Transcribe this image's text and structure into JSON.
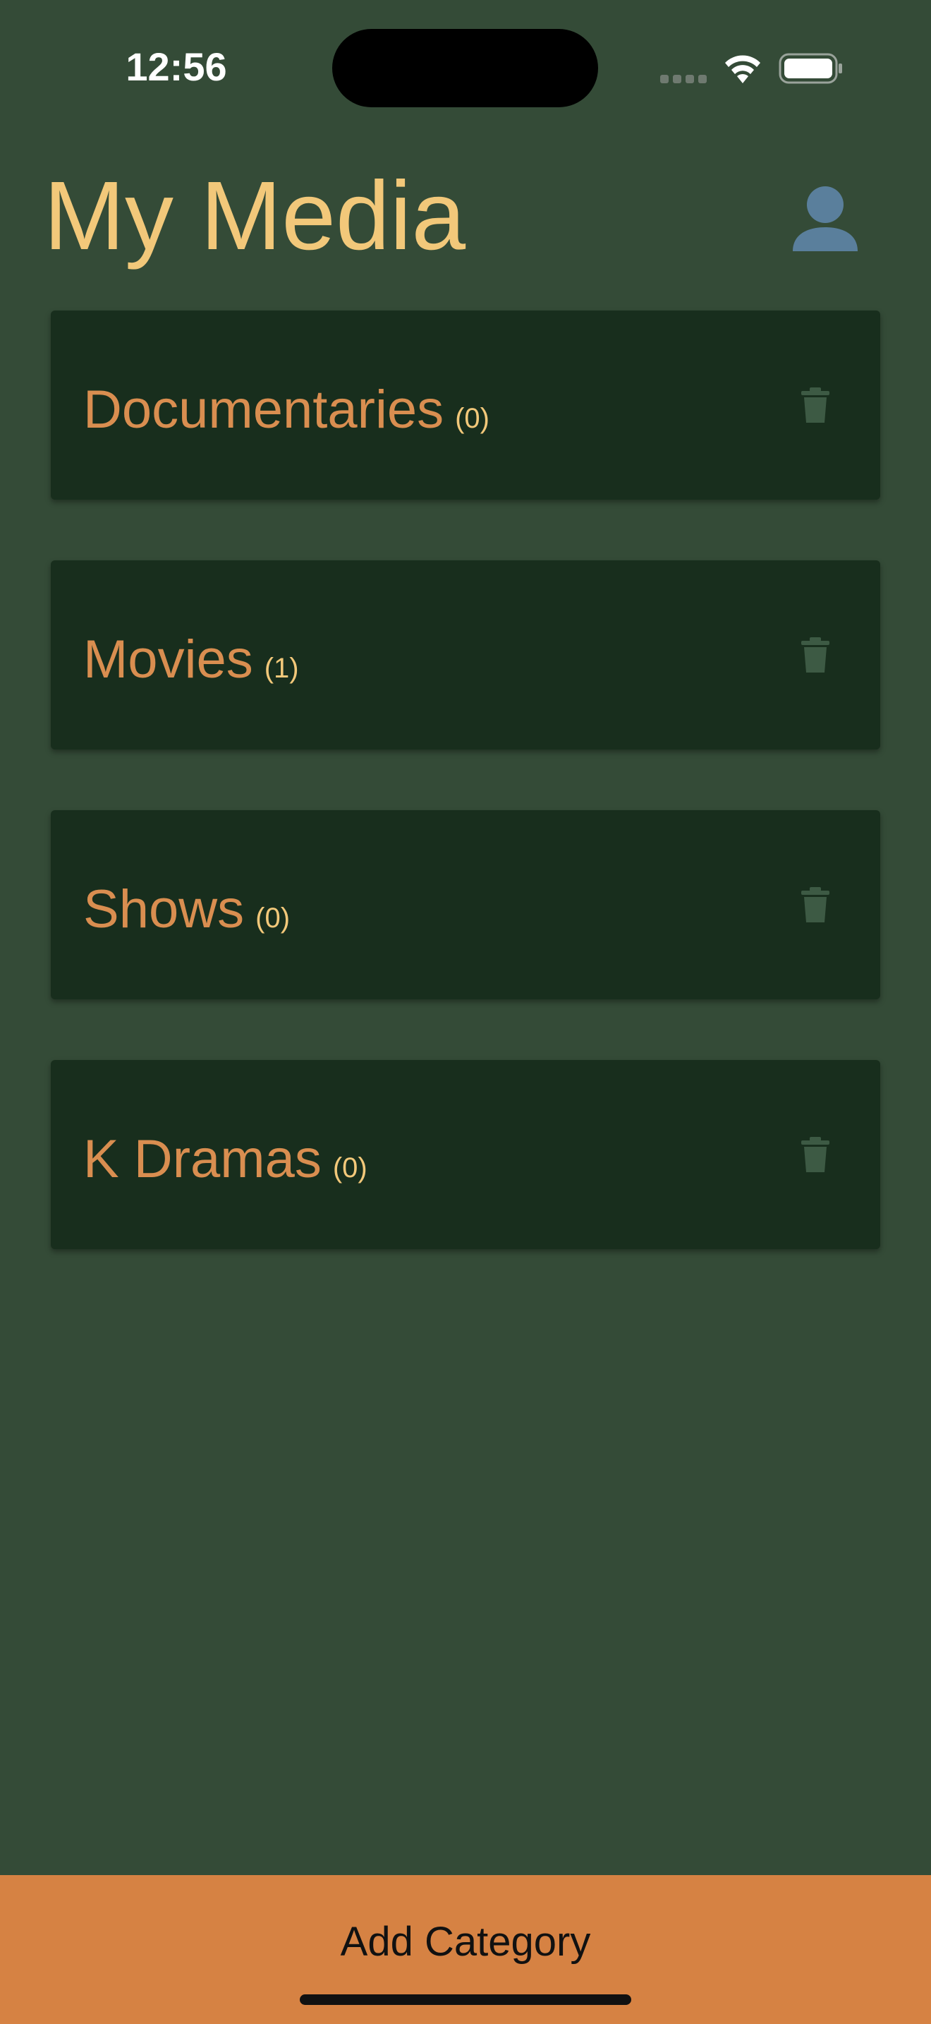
{
  "status_bar": {
    "time": "12:56",
    "icons": [
      "signal-icon",
      "wifi-icon",
      "battery-icon"
    ]
  },
  "header": {
    "title": "My Media",
    "profile_icon": "person-icon"
  },
  "categories": [
    {
      "name": "Documentaries",
      "count": "(0)",
      "delete_icon": "trash-icon"
    },
    {
      "name": "Movies",
      "count": "(1)",
      "delete_icon": "trash-icon"
    },
    {
      "name": "Shows",
      "count": "(0)",
      "delete_icon": "trash-icon"
    },
    {
      "name": "K Dramas",
      "count": "(0)",
      "delete_icon": "trash-icon"
    }
  ],
  "footer": {
    "add_label": "Add Category"
  },
  "colors": {
    "background": "#344b37",
    "card": "#182e1d",
    "title": "#f2c87a",
    "category_text": "#d98e50",
    "count_text": "#f2c87a",
    "icon_muted": "#3d5a44",
    "profile_icon": "#5a7f9c",
    "button_bar": "#d68243"
  }
}
